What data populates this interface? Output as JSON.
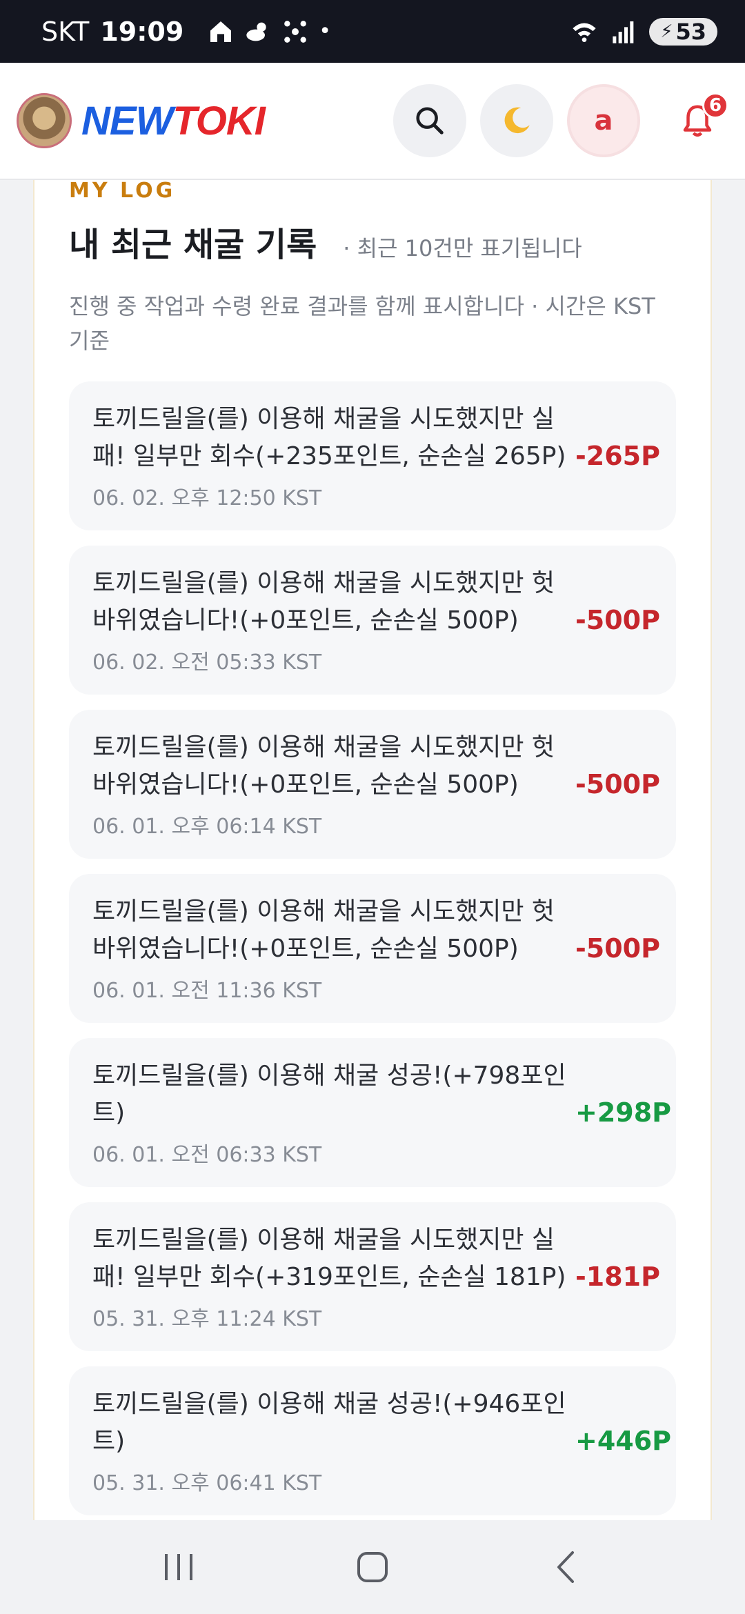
{
  "status_bar": {
    "carrier": "SKT",
    "time": "19:09",
    "battery": "53"
  },
  "header": {
    "logo_new": "NEW",
    "logo_toki": "TOKI",
    "user_initial": "a",
    "notification_count": "6"
  },
  "section": {
    "tag": "MY LOG",
    "title": "내 최근 채굴 기록",
    "subtitle": "· 최근 10건만 표기됩니다",
    "description": "진행 중 작업과 수령 완료 결과를 함께 표시합니다 · 시간은 KST 기준"
  },
  "logs": [
    {
      "text": "토끼드릴을(를) 이용해 채굴을 시도했지만 실패! 일부만 회수(+235포인트, 순손실 265P)",
      "time": "06. 02. 오후 12:50 KST",
      "amount": "-265P"
    },
    {
      "text": "토끼드릴을(를) 이용해 채굴을 시도했지만 헛바위였습니다!(+0포인트, 순손실 500P)",
      "time": "06. 02. 오전 05:33 KST",
      "amount": "-500P"
    },
    {
      "text": "토끼드릴을(를) 이용해 채굴을 시도했지만 헛바위였습니다!(+0포인트, 순손실 500P)",
      "time": "06. 01. 오후 06:14 KST",
      "amount": "-500P"
    },
    {
      "text": "토끼드릴을(를) 이용해 채굴을 시도했지만 헛바위였습니다!(+0포인트, 순손실 500P)",
      "time": "06. 01. 오전 11:36 KST",
      "amount": "-500P"
    },
    {
      "text": "토끼드릴을(를) 이용해 채굴 성공!(+798포인트)",
      "time": "06. 01. 오전 06:33 KST",
      "amount": "+298P"
    },
    {
      "text": "토끼드릴을(를) 이용해 채굴을 시도했지만 실패! 일부만 회수(+319포인트, 순손실 181P)",
      "time": "05. 31. 오후 11:24 KST",
      "amount": "-181P"
    },
    {
      "text": "토끼드릴을(를) 이용해 채굴 성공!(+946포인트)",
      "time": "05. 31. 오후 06:41 KST",
      "amount": "+446P"
    }
  ],
  "colors": {
    "negative": "#c5262c",
    "positive": "#179a43",
    "accent_tag": "#c97d0e"
  },
  "icons": {
    "search": "search-icon",
    "theme": "moon-icon",
    "bell": "bell-icon"
  }
}
